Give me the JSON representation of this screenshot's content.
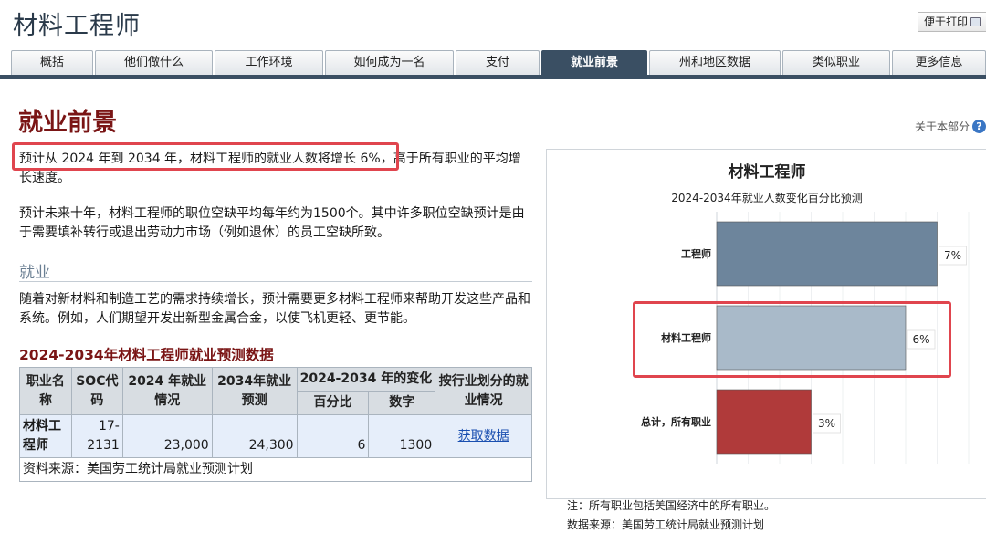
{
  "header": {
    "site_title": "材料工程师",
    "print_label": "便于打印"
  },
  "tabs": [
    {
      "label": "概括",
      "active": false
    },
    {
      "label": "他们做什么",
      "active": false
    },
    {
      "label": "工作环境",
      "active": false
    },
    {
      "label": "如何成为一名",
      "active": false
    },
    {
      "label": "支付",
      "active": false
    },
    {
      "label": "就业前景",
      "active": true
    },
    {
      "label": "州和地区数据",
      "active": false
    },
    {
      "label": "类似职业",
      "active": false
    },
    {
      "label": "更多信息",
      "active": false
    }
  ],
  "section": {
    "title": "就业前景",
    "about_label": "关于本部分",
    "about_icon": "question-icon",
    "para1": "预计从 2024 年到 2034 年，材料工程师的就业人数将增长 6%，高于所有职业的平均增长速度。",
    "para2": "预计未来十年，材料工程师的职位空缺平均每年约为1500个。其中许多职位空缺预计是由于需要填补转行或退出劳动力市场（例如退休）的员工空缺所致。",
    "subheading": "就业",
    "para3": "随着对新材料和制造工艺的需求持续增长，预计需要更多材料工程师来帮助开发这些产品和系统。例如，人们期望开发出新型金属合金，以使飞机更轻、更节能。"
  },
  "table": {
    "title": "2024-2034年材料工程师就业预测数据",
    "headers": {
      "occupation": "职业名称",
      "soc": "SOC代码",
      "emp2024": "2024 年就业情况",
      "emp2034": "2034年就业预测",
      "change": "2024-2034 年的变化",
      "pct": "百分比",
      "num": "数字",
      "industry": "按行业划分的就业情况"
    },
    "row": {
      "occupation": "材料工程师",
      "soc": "17-2131",
      "emp2024": "23,000",
      "emp2034": "24,300",
      "pct": "6",
      "num": "1300",
      "link": "获取数据"
    },
    "source": "资料来源：美国劳工统计局就业预测计划"
  },
  "chart_data": {
    "type": "bar",
    "orientation": "horizontal",
    "title": "材料工程师",
    "subtitle": "2024-2034年就业人数变化百分比预测",
    "categories": [
      "工程师",
      "材料工程师",
      "总计，所有职业"
    ],
    "values": [
      7,
      6,
      3
    ],
    "value_labels": [
      "7%",
      "6%",
      "3%"
    ],
    "colors": [
      "#6d859c",
      "#a9bac9",
      "#b03a3a"
    ],
    "xlim": [
      0,
      8
    ],
    "grid": true
  },
  "notes": {
    "note": "注：所有职业包括美国经济中的所有职业。",
    "source": "数据来源：美国劳工统计局就业预测计划"
  }
}
